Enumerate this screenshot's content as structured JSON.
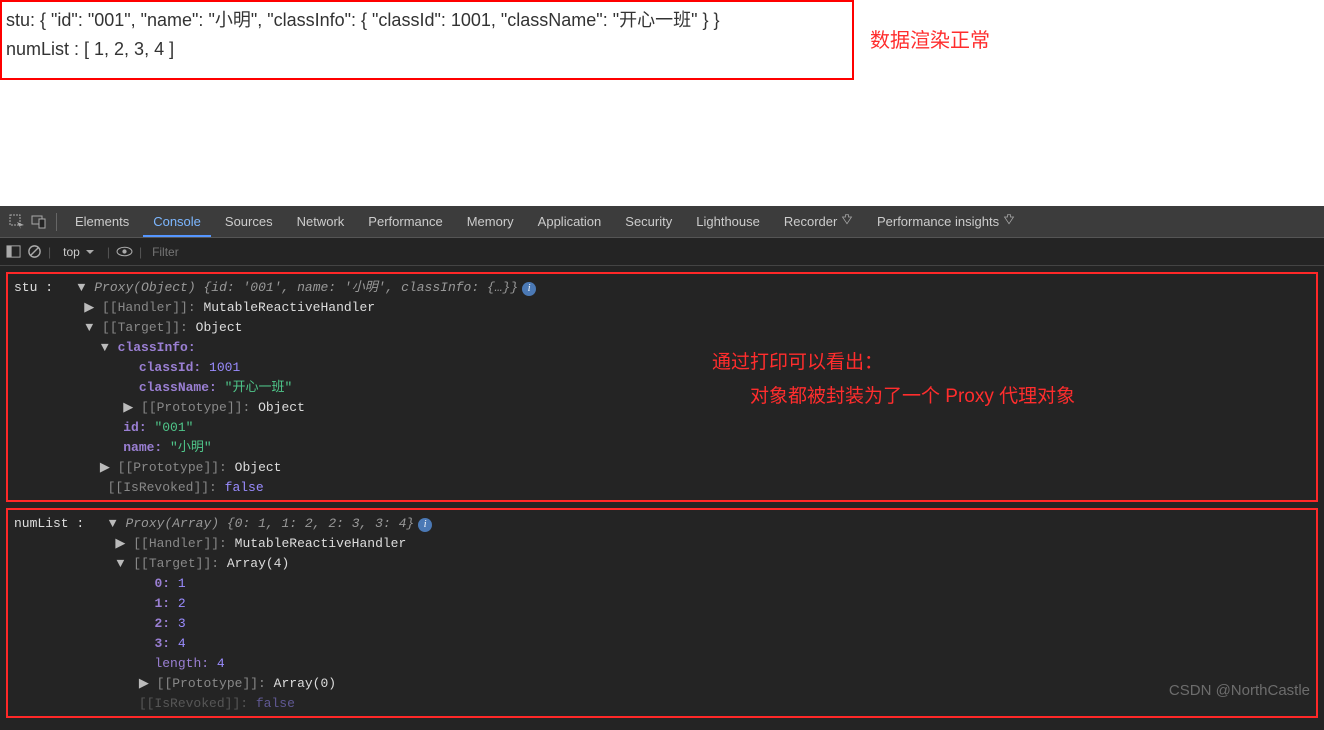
{
  "page": {
    "line1": "stu: { \"id\": \"001\", \"name\": \"小明\", \"classInfo\": { \"classId\": 1001, \"className\": \"开心一班\" } }",
    "line2": "numList : [ 1, 2, 3, 4 ]"
  },
  "annotation1": "数据渲染正常",
  "annotation2_l1": "通过打印可以看出：",
  "annotation2_l2": "　　对象都被封装为了一个 Proxy 代理对象",
  "devtools": {
    "tabs": {
      "elements": "Elements",
      "console": "Console",
      "sources": "Sources",
      "network": "Network",
      "performance": "Performance",
      "memory": "Memory",
      "application": "Application",
      "security": "Security",
      "lighthouse": "Lighthouse",
      "recorder": "Recorder",
      "perf_insights": "Performance insights"
    },
    "filterbar": {
      "context": "top",
      "filter_placeholder": "Filter"
    }
  },
  "console": {
    "block1": {
      "label": "stu :   ",
      "proxy": "Proxy(Object) ",
      "summary_open": "{",
      "s_id_k": "id: ",
      "s_id_v": "'001'",
      "s_name_k": ", name: ",
      "s_name_v": "'小明'",
      "s_ci_k": ", classInfo: ",
      "s_ci_v": "{…}",
      "summary_close": "}",
      "handler_l": "[[Handler]]: ",
      "handler_v": "MutableReactiveHandler",
      "target_l": "[[Target]]: ",
      "target_v": "Object",
      "classInfo_l": "classInfo:",
      "classId_k": "classId: ",
      "classId_v": "1001",
      "className_k": "className: ",
      "className_v": "\"开心一班\"",
      "proto_l": "[[Prototype]]: ",
      "proto_v": "Object",
      "id_k": "id: ",
      "id_v": "\"001\"",
      "name_k": "name: ",
      "name_v": "\"小明\"",
      "isrev_l": "[[IsRevoked]]: ",
      "isrev_v": "false"
    },
    "block2": {
      "label": "numList :   ",
      "proxy": "Proxy(Array) ",
      "summary_open": "{",
      "i0k": "0: ",
      "i0v": "1",
      "i1k": ", 1: ",
      "i1v": "2",
      "i2k": ", 2: ",
      "i2v": "3",
      "i3k": ", 3: ",
      "i3v": "4",
      "summary_close": "}",
      "handler_l": "[[Handler]]: ",
      "handler_v": "MutableReactiveHandler",
      "target_l": "[[Target]]: ",
      "target_v": "Array(4)",
      "a0k": "0: ",
      "a0v": "1",
      "a1k": "1: ",
      "a1v": "2",
      "a2k": "2: ",
      "a2v": "3",
      "a3k": "3: ",
      "a3v": "4",
      "len_k": "length: ",
      "len_v": "4",
      "proto_l": "[[Prototype]]: ",
      "proto_v": "Array(0)",
      "isrev_l": "[[IsRevoked]]: ",
      "isrev_v": "false"
    }
  },
  "watermark": "CSDN @NorthCastle"
}
